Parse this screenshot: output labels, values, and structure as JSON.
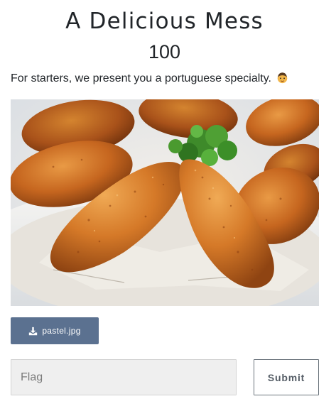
{
  "challenge": {
    "title": "A Delicious Mess",
    "value": "100",
    "description": "For starters, we present you a portuguese specialty.",
    "description_emoji": "man-face-emoji"
  },
  "image": {
    "subject": "plate of fried codfish cakes with parsley garnish"
  },
  "files": [
    {
      "label": "pastel.jpg",
      "icon": "download-icon"
    }
  ],
  "form": {
    "flag_placeholder": "Flag",
    "flag_value": "",
    "submit_label": "Submit"
  },
  "colors": {
    "download_button_bg": "#5b7190",
    "input_bg": "#efefef",
    "submit_border": "#6c757d"
  }
}
